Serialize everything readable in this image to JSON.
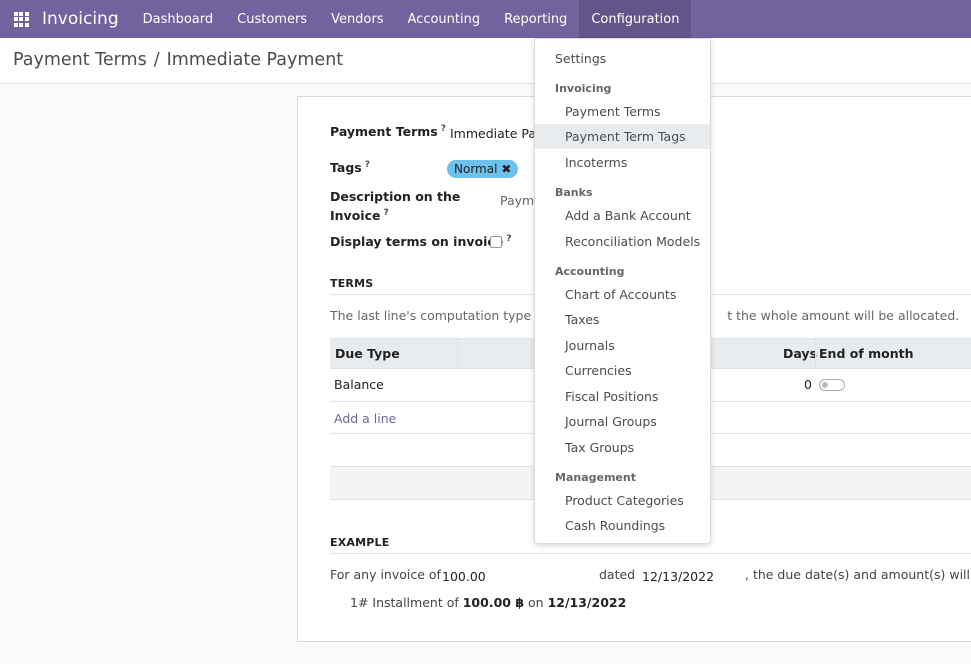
{
  "navbar": {
    "brand": "Invoicing",
    "items": [
      "Dashboard",
      "Customers",
      "Vendors",
      "Accounting",
      "Reporting",
      "Configuration"
    ]
  },
  "breadcrumb": {
    "parent": "Payment Terms",
    "separator": "/",
    "current": "Immediate Payment"
  },
  "form": {
    "payment_terms_label": "Payment Terms",
    "payment_terms_value": "Immediate Pay",
    "tags_label": "Tags",
    "tag": "Normal",
    "description_label_1": "Description on the",
    "description_label_2": "Invoice",
    "description_value": "Payme",
    "display_terms_label": "Display terms on invoice",
    "help_mark": "?",
    "terms_section": "TERMS",
    "hint_left": "The last line's computation type sho",
    "hint_right": "t the whole amount will be allocated.",
    "columns": {
      "due_type": "Due Type",
      "days": "Days",
      "end_of_month": "End of month"
    },
    "rows": [
      {
        "due_type": "Balance",
        "days": "0"
      }
    ],
    "add_line": "Add a line",
    "example_section": "EXAMPLE",
    "example": {
      "prefix": "For any invoice of",
      "amount": "100.00",
      "dated_label": "dated",
      "date": "12/13/2022",
      "suffix": ", the due date(s) and amount(s) will be:",
      "installment_prefix": "1# Installment of",
      "installment_amount": "100.00 ฿",
      "installment_on": "on",
      "installment_date": "12/13/2022"
    }
  },
  "dropdown": {
    "settings": "Settings",
    "sections": [
      {
        "header": "Invoicing",
        "items": [
          "Payment Terms",
          "Payment Term Tags",
          "Incoterms"
        ]
      },
      {
        "header": "Banks",
        "items": [
          "Add a Bank Account",
          "Reconciliation Models"
        ]
      },
      {
        "header": "Accounting",
        "items": [
          "Chart of Accounts",
          "Taxes",
          "Journals",
          "Currencies",
          "Fiscal Positions",
          "Journal Groups",
          "Tax Groups"
        ]
      },
      {
        "header": "Management",
        "items": [
          "Product Categories",
          "Cash Roundings"
        ]
      }
    ]
  }
}
